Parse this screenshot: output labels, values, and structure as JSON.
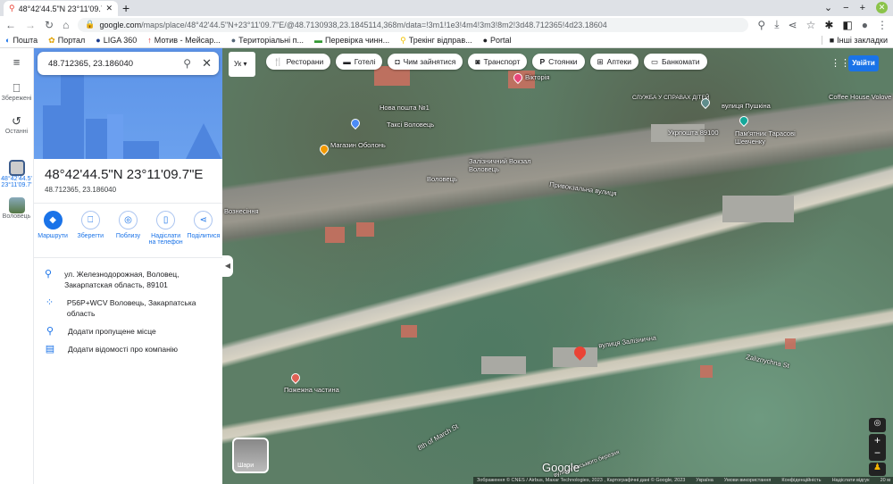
{
  "browser": {
    "tab_title": "48°42'44.5\"N 23°11'09.7\"E – Ка",
    "url_domain": "google.com",
    "url_path": "/maps/place/48°42'44.5\"N+23°11'09.7\"E/@48.7130938,23.1845114,368m/data=!3m1!1e3!4m4!3m3!8m2!3d48.712365!4d23.18604",
    "bookmarks": [
      "Пошта",
      "Портал",
      "LIGA 360",
      "Мотив - Мейсар...",
      "Територіальні п...",
      "Перевірка чинн...",
      "Трекінг відправ...",
      "Portal"
    ],
    "other_bookmarks": "Інші закладки"
  },
  "rail": {
    "saved": "Збережені",
    "recent": "Останні",
    "current": "48°42'44.5' 23°11'09.7'",
    "place": "Воловець"
  },
  "search": {
    "value": "48.712365, 23.186040"
  },
  "place": {
    "title": "48°42'44.5\"N 23°11'09.7\"E",
    "coords": "48.712365, 23.186040"
  },
  "actions": [
    "Маршрути",
    "Зберегти",
    "Поблизу",
    "Надіслати на телефон",
    "Поділитися"
  ],
  "info": [
    "ул. Железнодорожная, Воловец, Закарпатская область, 89101",
    "P56P+WCV Воловець, Закарпатська область",
    "Додати пропущене місце",
    "Додати відомості про компанію"
  ],
  "map": {
    "lang": "Ук",
    "chips": [
      "Ресторани",
      "Готелі",
      "Чим зайнятися",
      "Транспорт",
      "Стоянки",
      "Аптеки",
      "Банкомати"
    ],
    "login": "Увійти",
    "layers": "Шари",
    "labels": [
      "Нова пошта №1",
      "Таксі Воловець",
      "Вікторія",
      "Залізничний Вокзал Воловець",
      "Воловець",
      "Привокзальна вулиця",
      "вулиця Залізнична",
      "Zaliznychna St",
      "Пожежна частина",
      "вулиця Пушкіна",
      "Coffee House Volove",
      "Пам'ятник Тарасові Шевченку",
      "Укрпошта 89100",
      "СЛУЖБА У СПРАВАХ ДІТЕЙ",
      "8th of March St",
      "Вознесіння",
      "Магазин Оболонь",
      "вулиця Восьмого березня"
    ],
    "attribution": "Зображення © CNES / Airbus, Maxar Technologies, 2023 , Картографічні дані © Google, 2023",
    "links": [
      "Україна",
      "Умови використання",
      "Конфіденційність",
      "Надіслати відгук"
    ],
    "scale": "20 м",
    "logo": "Google"
  },
  "colors": {
    "accent": "#1a73e8",
    "pin": "#ea4335"
  }
}
